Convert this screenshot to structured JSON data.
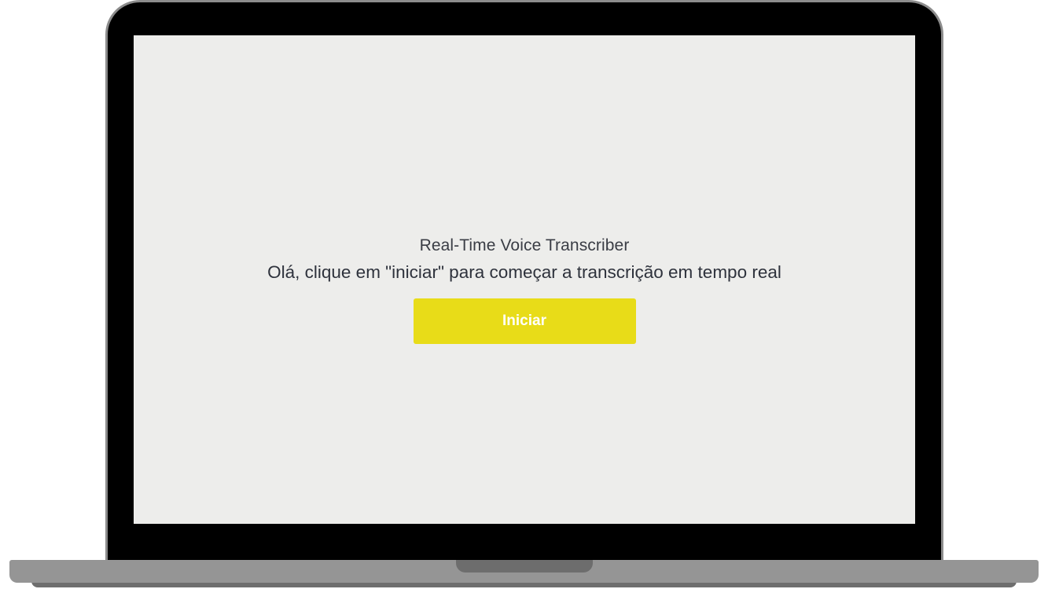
{
  "app": {
    "title": "Real-Time Voice Transcriber",
    "instruction": "Olá, clique em \"iniciar\" para começar a transcrição em tempo real"
  },
  "actions": {
    "start_label": "Iniciar"
  },
  "colors": {
    "screen_background": "#ededeb",
    "button_accent": "#e8dc18",
    "button_text": "#ffffff",
    "bezel": "#000000",
    "laptop_body": "#959595"
  }
}
